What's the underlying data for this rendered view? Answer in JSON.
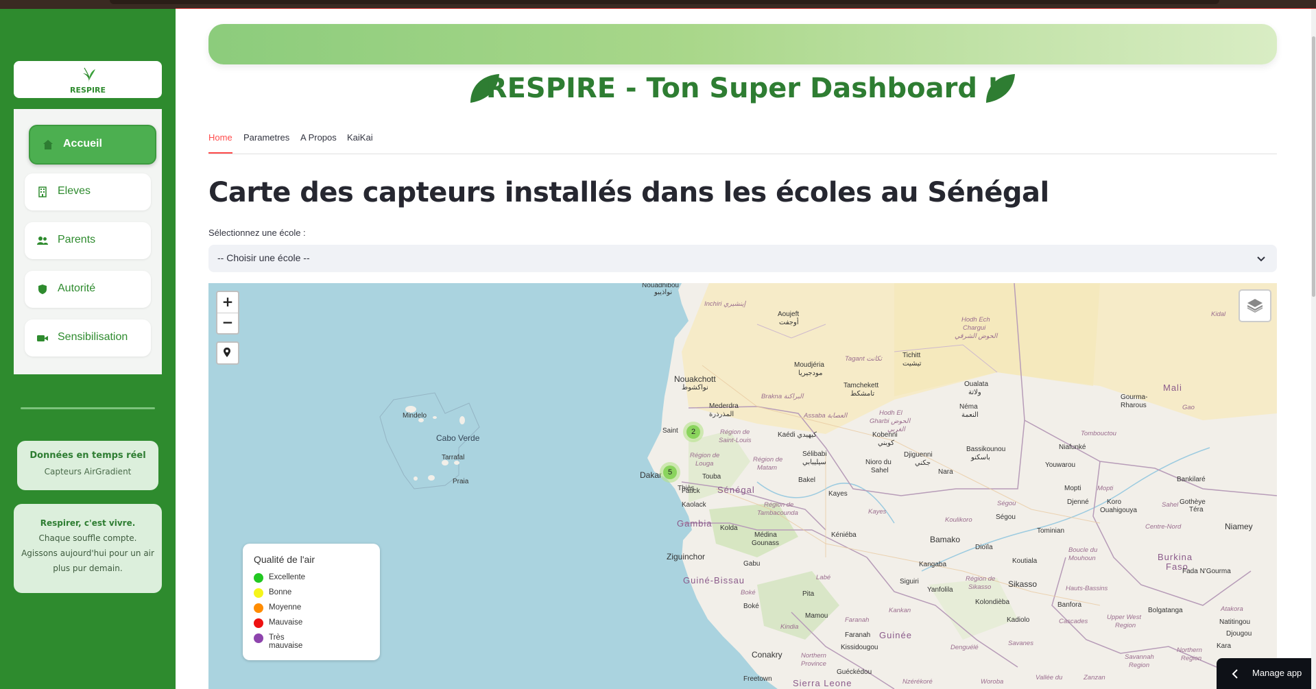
{
  "brand": {
    "logo_text": "RESPIRE",
    "primary_color": "#2e8b2e",
    "accent_color": "#4caf50"
  },
  "sidebar": {
    "items": [
      {
        "label": "Accueil",
        "icon": "home-icon",
        "active": true
      },
      {
        "label": "Eleves",
        "icon": "building-icon"
      },
      {
        "label": "Parents",
        "icon": "people-icon"
      },
      {
        "label": "Autorité",
        "icon": "shield-icon"
      },
      {
        "label": "Sensibilisation",
        "icon": "video-camera-icon"
      }
    ],
    "realtime_card": {
      "title": "Données en temps réel",
      "subtitle": "Capteurs AirGradient"
    },
    "quote_card": {
      "line1": "Respirer, c'est vivre.",
      "line2": "Chaque souffle compte.",
      "line3": "Agissons aujourd'hui pour un air",
      "line4": "plus pur demain."
    }
  },
  "header": {
    "title": "RESPIRE - Ton Super Dashboard !"
  },
  "tabs": [
    {
      "label": "Home",
      "active": true
    },
    {
      "label": "Parametres"
    },
    {
      "label": "A Propos"
    },
    {
      "label": "KaiKai"
    }
  ],
  "main": {
    "heading": "Carte des capteurs installés dans les écoles au Sénégal",
    "select_label": "Sélectionnez une école :",
    "select_value": "-- Choisir une école --"
  },
  "map": {
    "zoom_in": "+",
    "zoom_out": "−",
    "clusters": [
      {
        "count": "2"
      },
      {
        "count": "5"
      }
    ],
    "labels": {
      "nouadhibou": "Nouadhibou",
      "nouadhibou_ar": "نواذيبو",
      "inchiri": "Inchiri إينشيري",
      "aoujeft": "Aoujeft",
      "aoujeft_ar": "أوجفت",
      "hodh_ech": "Hodh Ech",
      "chargui": "Chargui",
      "hodh_ar": "الحوض الشرقي",
      "kidal": "Kidal",
      "tichitt": "Tichitt",
      "tichitt_ar": "تيشيت",
      "tagant": "Tagant تكانت",
      "moudjeria": "Moudjéria",
      "moudjeria_ar": "مودجيريا",
      "nouakchott": "Nouakchott",
      "nouakchott_ar": "نواكشوط",
      "tamchekett": "Tamchekett",
      "tamchekett_ar": "تامشكط",
      "oualata": "Oualata",
      "oualata_ar": "ولاتة",
      "mali": "Mali",
      "mindelo": "Mindelo",
      "cabo_verde": "Cabo Verde",
      "tarrafal": "Tarrafal",
      "praia": "Praia",
      "mederdra": "Mederdra",
      "mederdra_ar": "المذرذرة",
      "brakna": "Brakna البراكنة",
      "assaba": "Assaba العصابة",
      "hodh_el": "Hodh El",
      "gharbi": "Gharbi الحوض",
      "gharbi_ar": "الغربي",
      "nema": "Néma",
      "nema_ar": "النعمة",
      "gourma": "Gourma-",
      "rharous": "Rharous",
      "gao": "Gao",
      "saint": "Saint",
      "region_saint_louis": "Région de",
      "saint_louis": "Saint-Louis",
      "kaedi": "Kaédi كيهيدي",
      "kobenni": "Kobenni",
      "kobenni_ar": "كوبني",
      "tombouctou": "Tombouctou",
      "region_louga": "Région de",
      "louga": "Louga",
      "selibabi": "Sélibabi",
      "selibabi_ar": "سيليبابي",
      "djiguenni": "Djiguenni",
      "djiguenni_ar": "جكني",
      "bassikounou": "Bassikounou",
      "bassikounou_ar": "باسكنو",
      "niafunke": "Niafunké",
      "region_matam": "Région de",
      "matam": "Matam",
      "nioro": "Nioro du",
      "sahel": "Sahel",
      "nara": "Nara",
      "youwarou": "Youwarou",
      "dakar": "Dakar",
      "thies": "Thiès",
      "touba": "Touba",
      "senegal": "Sénégal",
      "bakel": "Bakel",
      "bankilare": "Bankilaré",
      "fatick": "Fatick",
      "kaolack": "Kaolack",
      "region_tamba": "Région de",
      "tambacounda": "Tambacounda",
      "kayes_city": "Kayes",
      "kayes": "Kayes",
      "mopti": "Mopti",
      "mopti_region": "Mopti",
      "koro": "Koro",
      "gotheye": "Gothèye",
      "segou_region": "Ségou",
      "segou": "Ségou",
      "djenne": "Djenné",
      "ouahigouya": "Ouahigouya",
      "sahel_bf": "Sahel",
      "tera": "Téra",
      "gambia": "Gambia",
      "kolda": "Kolda",
      "koulikoro": "Koulikoro",
      "tominian": "Tominian",
      "centre_nord": "Centre-Nord",
      "niamey": "Niamey",
      "medina": "Médina",
      "gounass": "Gounass",
      "kenieba": "Kéniéba",
      "bamako": "Bamako",
      "dioila": "Dioïla",
      "boucle": "Boucle du",
      "mouhoun": "Mouhoun",
      "burkina": "Burkina",
      "faso": "Faso",
      "ziguinchor": "Ziguinchor",
      "gabu": "Gabu",
      "kangaba": "Kangaba",
      "koutiala": "Koutiala",
      "fada": "Fada N'Gourma",
      "guinee_bissau": "Guiné-Bissau",
      "labe": "Labé",
      "siguiri": "Siguiri",
      "region_sikasso": "Région de",
      "sikasso_region": "Sikasso",
      "sikasso": "Sikasso",
      "hauts_bassins": "Hauts-Bassins",
      "yanfolila": "Yanfolila",
      "boke_region": "Boké",
      "boke": "Boké",
      "pita": "Pita",
      "kolondieba": "Kolondièba",
      "banfora": "Banfora",
      "bolgatanga": "Bolgatanga",
      "atakora": "Atakora",
      "kankan": "Kankan",
      "kindia": "Kindia",
      "mamou": "Mamou",
      "faranah_region": "Faranah",
      "faranah": "Faranah",
      "guinee": "Guinée",
      "kadiolo": "Kadiolo",
      "cascades": "Cascades",
      "upper_west": "Upper West",
      "region_uw": "Region",
      "natitingou": "Natitingou",
      "djougou": "Djougou",
      "kissidougou": "Kissidougou",
      "denguele": "Denguélé",
      "savanes": "Savanes",
      "conakry": "Conakry",
      "northern": "Northern",
      "province": "Province",
      "gueckedou": "Guéckédou",
      "northern_region": "Northern",
      "region_n": "Region",
      "kara": "Kara",
      "savannah": "Savannah",
      "region_s": "Region",
      "freetown": "Freetown",
      "sierra_leone": "Sierra Leone",
      "nzerekore": "Nzérékoré",
      "woroba": "Woroba",
      "vallee": "Vallée du",
      "zanzan": "Zanzan"
    }
  },
  "legend": {
    "title": "Qualité de l'air",
    "items": [
      {
        "label": "Excellente",
        "color": "#22c822"
      },
      {
        "label": "Bonne",
        "color": "#f5f51a"
      },
      {
        "label": "Moyenne",
        "color": "#ff8c00"
      },
      {
        "label": "Mauvaise",
        "color": "#ee1111"
      },
      {
        "label": "Très mauvaise",
        "color": "#8e44ad"
      }
    ]
  },
  "manage_app": {
    "label": "Manage app"
  }
}
